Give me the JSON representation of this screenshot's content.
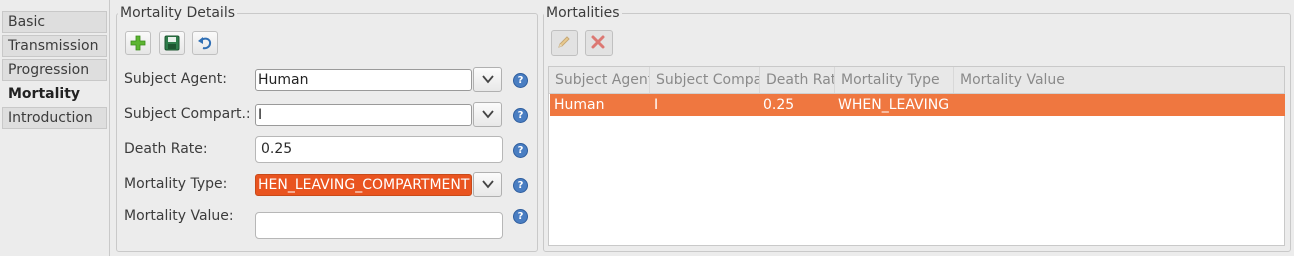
{
  "tabs": [
    {
      "label": "Basic"
    },
    {
      "label": "Transmission"
    },
    {
      "label": "Progression"
    },
    {
      "label": "Mortality"
    },
    {
      "label": "Introduction"
    }
  ],
  "details": {
    "title": "Mortality Details",
    "toolbar": {
      "add_icon": "plus-icon",
      "save_icon": "save-icon",
      "undo_icon": "undo-icon"
    },
    "fields": {
      "subject_agent": {
        "label": "Subject Agent:",
        "value": "Human"
      },
      "subject_compart": {
        "label": "Subject Compart.:",
        "value": "I"
      },
      "death_rate": {
        "label": "Death Rate:",
        "value": "0.25"
      },
      "mortality_type": {
        "label": "Mortality Type:",
        "value": "HEN_LEAVING_COMPARTMENT"
      },
      "mortality_value": {
        "label": "Mortality Value:",
        "value": ""
      }
    },
    "help_glyph": "?"
  },
  "mortalities": {
    "title": "Mortalities",
    "toolbar": {
      "edit_icon": "pencil-icon",
      "delete_icon": "delete-icon"
    },
    "columns": [
      "Subject Agent",
      "Subject Compar",
      "Death Rat",
      "Mortality Type",
      "Mortality Value"
    ],
    "rows": [
      [
        "Human",
        "I",
        "0.25",
        "WHEN_LEAVING",
        ""
      ]
    ]
  },
  "colors": {
    "selection": "#ef7740",
    "accent": "#e95420",
    "help": "#4a7ec2"
  }
}
